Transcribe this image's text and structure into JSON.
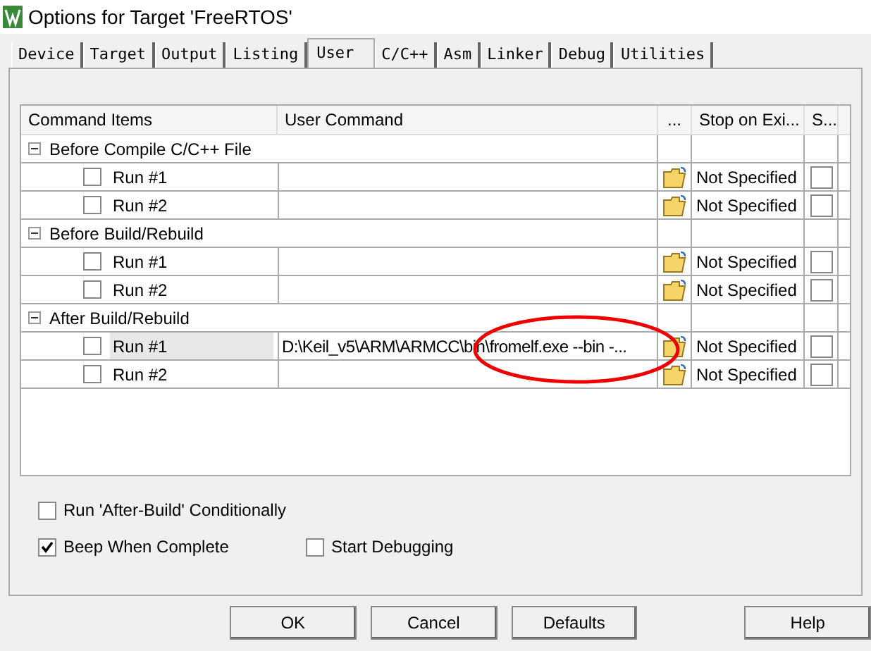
{
  "window": {
    "title": "Options for Target 'FreeRTOS'"
  },
  "tabs": [
    {
      "label": "Device",
      "selected": false
    },
    {
      "label": "Target",
      "selected": false
    },
    {
      "label": "Output",
      "selected": false
    },
    {
      "label": "Listing",
      "selected": false
    },
    {
      "label": "User",
      "selected": true
    },
    {
      "label": "C/C++",
      "selected": false
    },
    {
      "label": "Asm",
      "selected": false
    },
    {
      "label": "Linker",
      "selected": false
    },
    {
      "label": "Debug",
      "selected": false
    },
    {
      "label": "Utilities",
      "selected": false
    }
  ],
  "table": {
    "columns": [
      "Command Items",
      "User Command",
      "...",
      "Stop on Exi...",
      "S..."
    ],
    "groups": [
      {
        "label": "Before Compile C/C++ File",
        "expanded": true,
        "children": [
          {
            "label": "Run #1",
            "checked": false,
            "selected": false,
            "stop_on_exit": "Not Specified",
            "s_checked": false
          },
          {
            "label": "Run #2",
            "checked": false,
            "selected": false,
            "stop_on_exit": "Not Specified",
            "s_checked": false
          }
        ]
      },
      {
        "label": "Before Build/Rebuild",
        "expanded": true,
        "children": [
          {
            "label": "Run #1",
            "checked": false,
            "selected": false,
            "stop_on_exit": "Not Specified",
            "s_checked": false
          },
          {
            "label": "Run #2",
            "checked": false,
            "selected": false,
            "stop_on_exit": "Not Specified",
            "s_checked": false
          }
        ]
      },
      {
        "label": "After Build/Rebuild",
        "expanded": true,
        "children": [
          {
            "label": "Run #1",
            "checked": false,
            "selected": true,
            "command": "D:\\Keil_v5\\ARM\\ARMCC\\bin\\fromelf.exe --bin -...",
            "stop_on_exit": "Not Specified",
            "s_checked": false
          },
          {
            "label": "Run #2",
            "checked": false,
            "selected": false,
            "stop_on_exit": "Not Specified",
            "s_checked": false
          }
        ]
      }
    ]
  },
  "options": [
    {
      "label": "Run 'After-Build' Conditionally",
      "checked": false
    },
    {
      "label": "Beep When Complete",
      "checked": true
    },
    {
      "label": "Start Debugging",
      "checked": false
    }
  ],
  "buttons": [
    "OK",
    "Cancel",
    "Defaults",
    "Help"
  ]
}
